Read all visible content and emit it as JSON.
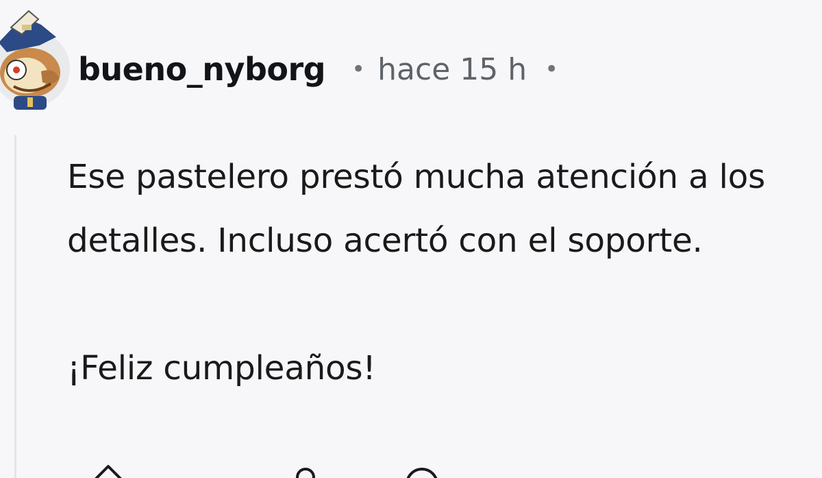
{
  "comment": {
    "author": "bueno_nyborg",
    "separator": "•",
    "timestamp": "hace 15 h",
    "body": [
      "Ese pastelero prestó mucha atención a los detalles. Incluso acertó con el soporte.",
      "¡Feliz cumpleaños!"
    ]
  },
  "icons": {
    "avatar": "snoo-avatar",
    "upvote": "upvote-arrow-icon",
    "award": "award-icon",
    "reply": "comment-bubble-icon"
  },
  "colors": {
    "background": "#f7f7f9",
    "username": "#111418",
    "meta": "#5f6368",
    "body_text": "#1a1a1b",
    "thread_line": "#e3e4e8"
  }
}
